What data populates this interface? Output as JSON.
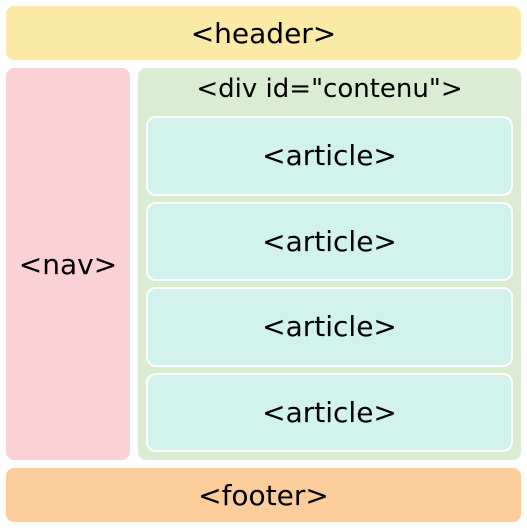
{
  "header": {
    "label": "<header>"
  },
  "nav": {
    "label": "<nav>"
  },
  "content": {
    "label": "<div id=\"contenu\">",
    "articles": [
      {
        "label": "<article>"
      },
      {
        "label": "<article>"
      },
      {
        "label": "<article>"
      },
      {
        "label": "<article>"
      }
    ]
  },
  "footer": {
    "label": "<footer>"
  }
}
